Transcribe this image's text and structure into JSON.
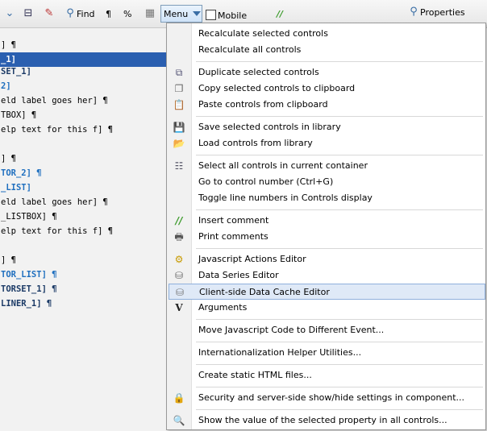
{
  "toolbar": {
    "find_label": "Find",
    "pilcrow": "¶",
    "percent": "%",
    "menu_label": "Menu",
    "mobile_label": "Mobile",
    "comment_glyph": "//",
    "properties_label": "Properties"
  },
  "left_lines": [
    "] ¶",
    "_1]",
    "SET_1]",
    "2]",
    "eld label goes her] ¶",
    "TBOX] ¶",
    "elp text for this f] ¶",
    "] ¶",
    "TOR_2] ¶",
    "_LIST]",
    "eld label goes her] ¶",
    "_LISTBOX] ¶",
    "elp text for this f] ¶",
    "] ¶",
    "TOR_LIST] ¶",
    "TORSET_1] ¶",
    "LINER_1] ¶"
  ],
  "menu": {
    "items": [
      {
        "label": "Recalculate selected controls",
        "icon": "none"
      },
      {
        "label": "Recalculate all controls",
        "icon": "none"
      },
      {
        "label": "Duplicate selected controls",
        "icon": "duplicate-icon"
      },
      {
        "label": "Copy selected controls to clipboard",
        "icon": "copy-icon"
      },
      {
        "label": "Paste controls from clipboard",
        "icon": "paste-icon"
      },
      {
        "label": "Save selected controls in library",
        "icon": "save-icon"
      },
      {
        "label": "Load controls from library",
        "icon": "folder-icon"
      },
      {
        "label": "Select all controls in current container",
        "icon": "tree-icon"
      },
      {
        "label": "Go to control number (Ctrl+G)",
        "icon": "none"
      },
      {
        "label": "Toggle line numbers in Controls display",
        "icon": "none"
      },
      {
        "label": "Insert comment",
        "icon": "comment-icon"
      },
      {
        "label": "Print comments",
        "icon": "printer-icon"
      },
      {
        "label": "Javascript Actions Editor",
        "icon": "actions-icon"
      },
      {
        "label": "Data Series Editor",
        "icon": "database-icon"
      },
      {
        "label": "Client-side Data Cache Editor",
        "icon": "cache-icon"
      },
      {
        "label": "Arguments",
        "icon": "arguments-icon"
      },
      {
        "label": "Move Javascript Code to Different Event...",
        "icon": "none"
      },
      {
        "label": "Internationalization Helper Utilities...",
        "icon": "none"
      },
      {
        "label": "Create static HTML files...",
        "icon": "none"
      },
      {
        "label": "Security and server-side show/hide settings in component...",
        "icon": "lock-icon"
      },
      {
        "label": "Show the value of the selected property in all controls...",
        "icon": "magnify-icon"
      }
    ]
  }
}
